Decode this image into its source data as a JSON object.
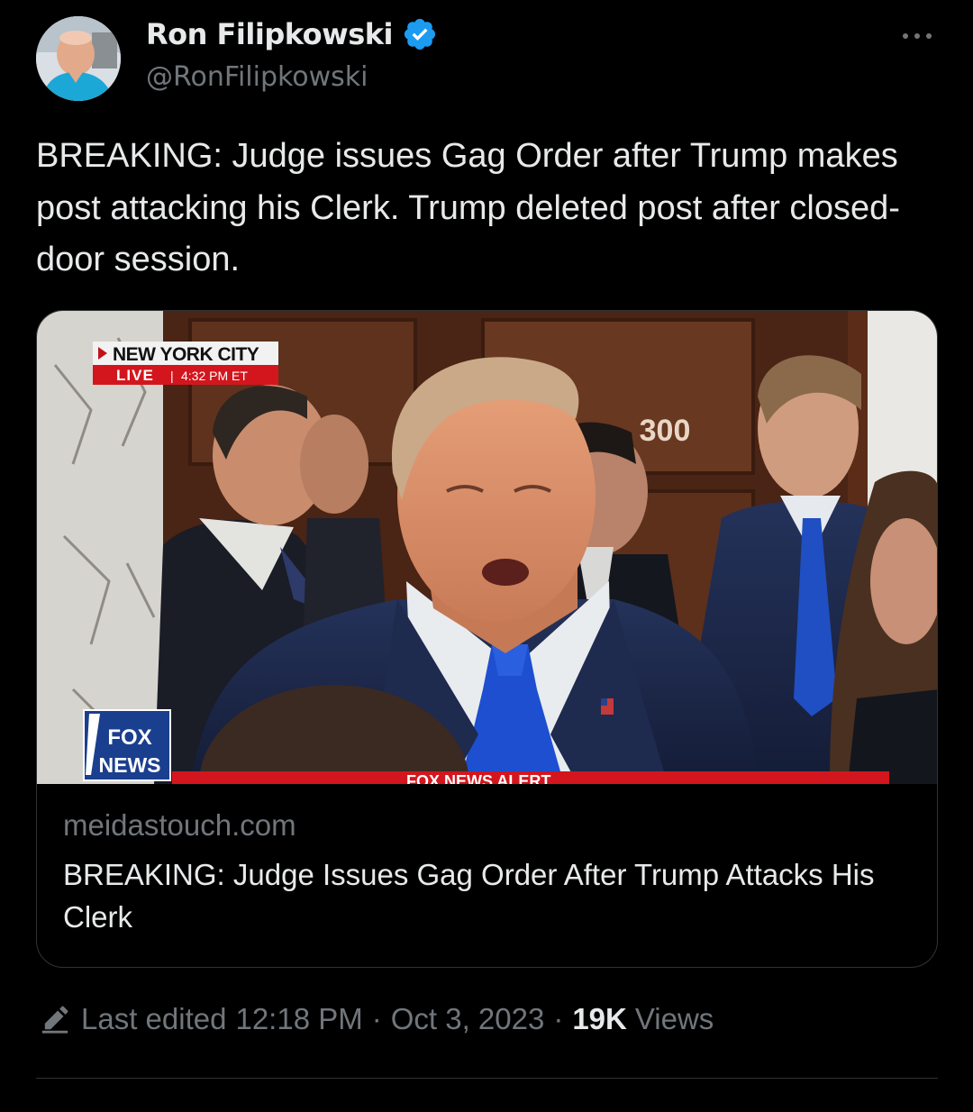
{
  "author": {
    "display_name": "Ron Filipkowski",
    "handle": "@RonFilipkowski",
    "verified": true,
    "avatar_icon": "profile-photo"
  },
  "tweet": {
    "text": "BREAKING: Judge issues Gag Order after Trump makes post attacking his Clerk. Trump deleted post after closed-door session."
  },
  "card": {
    "domain": "meidastouch.com",
    "title": "BREAKING: Judge Issues Gag Order After Trump Attacks His Clerk",
    "media": {
      "location_label": "NEW YORK CITY",
      "live_label": "LIVE",
      "time_label": "4:32 PM ET",
      "door_number": "300",
      "network_logo_top": "FOX",
      "network_logo_bottom": "NEWS",
      "ticker_text": "FOX NEWS ALERT"
    }
  },
  "meta": {
    "edited_label": "Last edited",
    "time": "12:18 PM",
    "separator": "·",
    "date": "Oct 3, 2023",
    "views_count": "19K",
    "views_label": "Views"
  },
  "colors": {
    "background": "#000000",
    "text_primary": "#e7e9ea",
    "text_secondary": "#71767b",
    "verified_blue": "#1d9bf0",
    "border": "#2f3336",
    "fox_red": "#d3161e"
  }
}
